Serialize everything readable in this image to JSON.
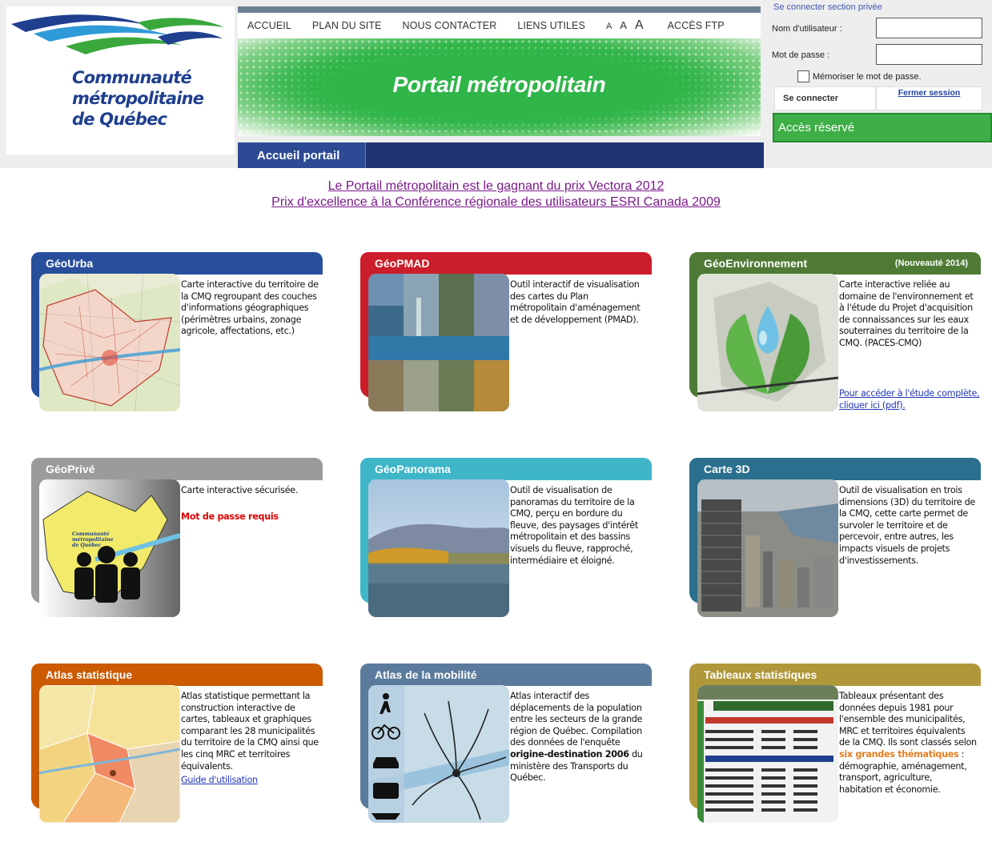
{
  "logo": {
    "line1": "Communauté",
    "line2": "métropolitaine",
    "line3": "de Québec"
  },
  "topnav": {
    "accueil": "ACCUEIL",
    "plan": "PLAN DU SITE",
    "contact": "NOUS CONTACTER",
    "liens": "LIENS UTILES",
    "font_small": "A",
    "font_medium": "A",
    "font_large": "A",
    "ftp": "ACCÈS FTP"
  },
  "banner": {
    "title": "Portail métropolitain"
  },
  "subnav": {
    "tab": "Accueil portail"
  },
  "login": {
    "title": "Se connecter section privée",
    "user_label": "Nom d'utilisateur :",
    "pass_label": "Mot de passe :",
    "remember": "Mémoriser le mot de passe.",
    "connect": "Se connecter",
    "close": "Fermer session",
    "reserved": "Accès réservé"
  },
  "prizes": {
    "line1": "Le Portail métropolitain est le gagnant du prix Vectora 2012",
    "line2": "Prix d'excellence à la Conférence régionale des utilisateurs ESRI Canada 2009"
  },
  "colors": {
    "geourba": "#284f9c",
    "geopmad": "#cc1d2a",
    "geoenv": "#4e7a35",
    "geoprive": "#9b9b9b",
    "geopanorama": "#3fb6c8",
    "carte3d": "#2a6f8d",
    "atlas": "#cc5a00",
    "mobilite": "#5a7b9c",
    "tableaux": "#b0983a",
    "header_bg": "#eeeeee",
    "banner_green": "#2fb548",
    "subnav": "#1f3572",
    "acces": "#3eae47"
  },
  "cards": {
    "geourba": {
      "title": "GéoUrba",
      "desc": "Carte interactive du territoire de la CMQ regroupant des couches d'informations géographiques (périmètres urbains, zonage agricole, affectations, etc.)"
    },
    "geopmad": {
      "title": "GéoPMAD",
      "desc": "Outil interactif de visualisation des cartes du Plan métropolitain d'aménagement et de développement (PMAD)."
    },
    "geoenv": {
      "title": "GéoEnvironnement",
      "badge": "(Nouveauté 2014)",
      "desc": "Carte interactive reliée au domaine de l'environnement et à l'étude du Projet d'acquisition de connaissances sur les eaux souterraines du territoire de la CMQ. (PACES-CMQ)",
      "link": "Pour accéder à l'étude complète, cliquer ici (pdf)."
    },
    "geoprive": {
      "title": "GéoPrivé",
      "desc": "Carte interactive sécurisée.",
      "required": "Mot de passe requis",
      "logo_l1": "Communauté",
      "logo_l2": "métropolitaine",
      "logo_l3": "de Québec"
    },
    "geopanorama": {
      "title": "GéoPanorama",
      "desc": "Outil de visualisation de panoramas du territoire de la CMQ, perçu en bordure du fleuve, des paysages d'intérêt métropolitain et des bassins visuels du fleuve, rapproché, intermédiaire et éloigné."
    },
    "carte3d": {
      "title": "Carte 3D",
      "desc": "Outil de visualisation en trois dimensions (3D) du territoire de la CMQ, cette carte permet de survoler le territoire et de percevoir, entre autres, les impacts visuels de projets d'investissements."
    },
    "atlas": {
      "title": "Atlas statistique",
      "desc": "Atlas statistique permettant la construction interactive de cartes, tableaux et graphiques comparant les 28 municipalités du territoire de la CMQ ainsi que les cinq MRC et territoires équivalents.",
      "link": "Guide d'utilisation"
    },
    "mobilite": {
      "title": "Atlas de la mobilité",
      "desc_a": "Atlas interactif des déplacements de la population entre les secteurs de la grande région de Québec. Compilation des données de l'enquête ",
      "desc_b": "origine-destination 2006",
      "desc_c": " du ministère des Transports du Québec."
    },
    "tableaux": {
      "title": "Tableaux statistiques",
      "desc_a": "Tableaux présentant des données depuis 1981 pour l'ensemble des municipalités, MRC et territoires équivalents de la CMQ. Ils sont classés selon ",
      "desc_b": "six grandes thématiques",
      "desc_c": " : démographie, aménagement, transport, agriculture, habitation et économie."
    }
  }
}
